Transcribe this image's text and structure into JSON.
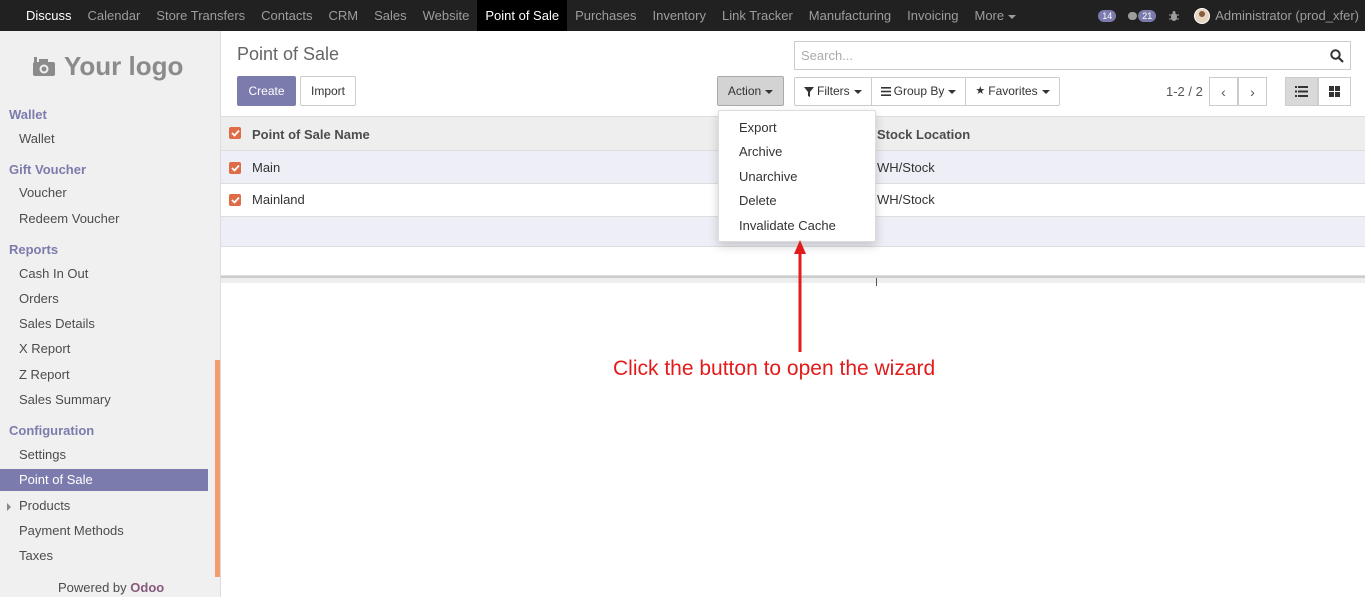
{
  "topbar": {
    "menu": [
      "Discuss",
      "Calendar",
      "Store Transfers",
      "Contacts",
      "CRM",
      "Sales",
      "Website",
      "Point of Sale",
      "Purchases",
      "Inventory",
      "Link Tracker",
      "Manufacturing",
      "Invoicing",
      "More"
    ],
    "active": "Point of Sale",
    "messages_count": "14",
    "chat_count": "21",
    "user": "Administrator (prod_xfer)"
  },
  "sidebar": {
    "logo_text": "Your logo",
    "sections": {
      "wallet": "Wallet",
      "gift_voucher": "Gift Voucher",
      "reports": "Reports",
      "configuration": "Configuration"
    },
    "items": {
      "wallet": "Wallet",
      "voucher": "Voucher",
      "redeem_voucher": "Redeem Voucher",
      "cash_in_out": "Cash In Out",
      "orders": "Orders",
      "sales_details": "Sales Details",
      "x_report": "X Report",
      "z_report": "Z Report",
      "sales_summary": "Sales Summary",
      "settings": "Settings",
      "point_of_sale": "Point of Sale",
      "products": "Products",
      "payment_methods": "Payment Methods",
      "taxes": "Taxes"
    },
    "powered_by": "Powered by",
    "powered_brand": "Odoo"
  },
  "control": {
    "title": "Point of Sale",
    "create": "Create",
    "import": "Import",
    "action": "Action",
    "search_placeholder": "Search...",
    "filters": "Filters",
    "group_by": "Group By",
    "favorites": "Favorites",
    "pager": "1-2 / 2"
  },
  "table": {
    "columns": [
      "Point of Sale Name",
      "Stock Location"
    ],
    "rows": [
      {
        "name": "Main",
        "location": "WH/Stock"
      },
      {
        "name": "Mainland",
        "location": "WH/Stock"
      }
    ]
  },
  "action_menu": [
    "Export",
    "Archive",
    "Unarchive",
    "Delete",
    "Invalidate Cache"
  ],
  "annotation": "Click the button to open the wizard",
  "colors": {
    "brand": "#7c7bad",
    "checkbox": "#e06c47",
    "annotation": "#e31b1b",
    "navbar": "#212121"
  }
}
